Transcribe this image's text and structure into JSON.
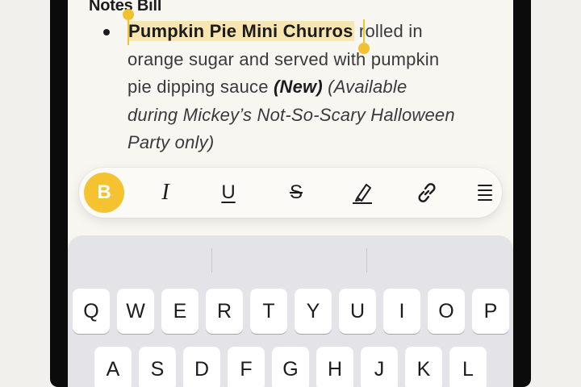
{
  "note": {
    "title": "Notes Bill",
    "selected_text": "Pumpkin Pie Mini Churros",
    "line1_rest": " rolled in",
    "line2": "orange sugar and served with pumpkin",
    "line3_a": "pie dipping sauce ",
    "new_tag": "(New)",
    "line3_b": " (Available",
    "line4": "during Mickey’s Not-So-Scary Halloween",
    "line5": "Party only)"
  },
  "format_bar": {
    "bold": "B",
    "italic": "I",
    "underline": "U",
    "strikethrough": "S",
    "icons": [
      "highlighter-icon",
      "link-icon",
      "list-icon"
    ]
  },
  "keyboard": {
    "row1": [
      "Q",
      "W",
      "E",
      "R",
      "T",
      "Y",
      "U",
      "I",
      "O",
      "P"
    ],
    "row2": [
      "A",
      "S",
      "D",
      "F",
      "G",
      "H",
      "J",
      "K",
      "L"
    ]
  },
  "colors": {
    "accent": "#f4c32f",
    "selection": "#f7e6b0"
  }
}
